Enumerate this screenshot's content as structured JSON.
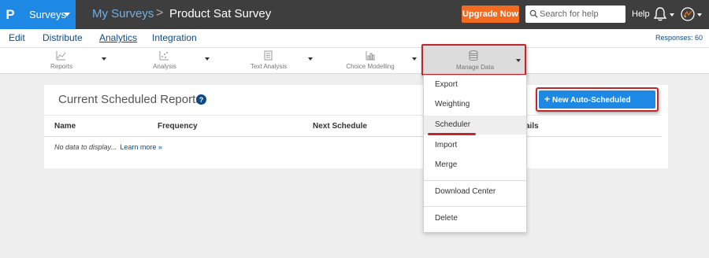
{
  "app": {
    "logo": "P",
    "surveys_menu": "Surveys"
  },
  "breadcrumb": {
    "parent": "My Surveys",
    "separator": ">",
    "current": "Product Sat Survey"
  },
  "header": {
    "upgrade_label": "Upgrade Now",
    "search_placeholder": "Search for help",
    "help_label": "Help"
  },
  "nav": {
    "items": [
      "Edit",
      "Distribute",
      "Analytics",
      "Integration"
    ],
    "active": "Analytics",
    "responses": "Responses: 60"
  },
  "toolbar": {
    "items": [
      "Reports",
      "Analysis",
      "Text Analysis",
      "Choice Modelling",
      "Manage Data"
    ]
  },
  "panel": {
    "title": "Current Scheduled Reports",
    "new_button": "New Auto-Scheduled Report",
    "columns": [
      "Name",
      "Frequency",
      "Next Schedule",
      "ails"
    ],
    "empty_text": "No data to display...",
    "learn_more": "Learn more »"
  },
  "dropdown": {
    "items": [
      "Export",
      "Weighting",
      "Scheduler",
      "Import",
      "Merge",
      "Download Center",
      "Delete"
    ],
    "highlighted": "Scheduler"
  },
  "colors": {
    "brand_blue": "#1e88e5",
    "upgrade_orange": "#f36b21",
    "topbar": "#3e3e3e",
    "highlight_red": "#c0272d",
    "link_blue": "#0c4a8a"
  },
  "icons": {
    "reports": "line-chart-icon",
    "analysis": "scatter-icon",
    "text_analysis": "document-icon",
    "choice_modelling": "bar-chart-icon",
    "manage_data": "database-icon"
  }
}
